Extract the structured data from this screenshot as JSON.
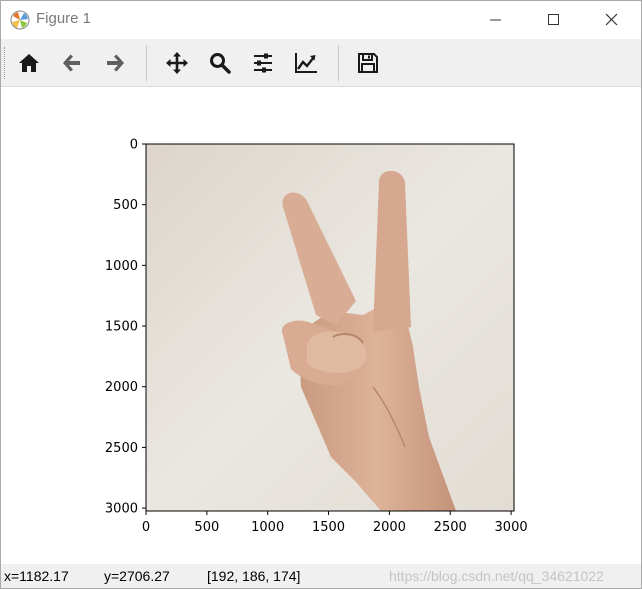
{
  "window": {
    "title": "Figure 1"
  },
  "toolbar": {
    "buttons": [
      {
        "name": "home-button",
        "icon": "home-icon"
      },
      {
        "name": "back-button",
        "icon": "arrow-left-icon"
      },
      {
        "name": "forward-button",
        "icon": "arrow-right-icon"
      },
      {
        "name": "pan-button",
        "icon": "move-icon"
      },
      {
        "name": "zoom-button",
        "icon": "magnifier-icon"
      },
      {
        "name": "subplots-button",
        "icon": "sliders-icon"
      },
      {
        "name": "edit-axis-button",
        "icon": "line-chart-icon"
      },
      {
        "name": "save-button",
        "icon": "floppy-disk-icon"
      }
    ]
  },
  "plot": {
    "x_ticks": [
      "0",
      "500",
      "1000",
      "1500",
      "2000",
      "2500",
      "3000"
    ],
    "y_ticks": [
      "0",
      "500",
      "1000",
      "1500",
      "2000",
      "2500",
      "3000"
    ],
    "image_extent": [
      3024,
      3024
    ]
  },
  "status": {
    "x_readout": "x=1182.17",
    "y_readout": "y=2706.27",
    "pixel_value": "[192, 186, 174]",
    "watermark": "https://blog.csdn.net/qq_34621022"
  }
}
